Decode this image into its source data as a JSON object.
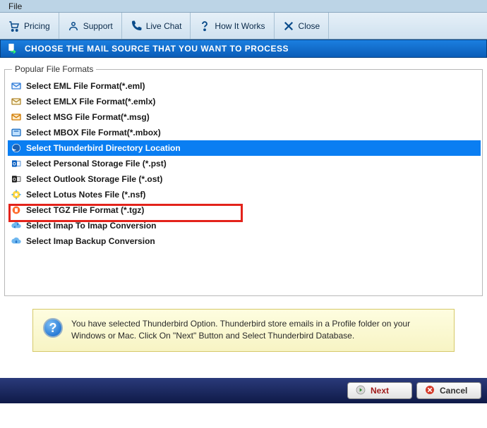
{
  "menubar": {
    "file": "File"
  },
  "toolbar": {
    "pricing": "Pricing",
    "support": "Support",
    "livechat": "Live Chat",
    "howitworks": "How It Works",
    "close": "Close"
  },
  "header": {
    "title": "CHOOSE THE MAIL SOURCE THAT YOU WANT TO PROCESS"
  },
  "group": {
    "legend": "Popular File Formats"
  },
  "formats": {
    "items": [
      {
        "label": "Select EML File Format(*.eml)"
      },
      {
        "label": "Select EMLX File Format(*.emlx)"
      },
      {
        "label": "Select MSG File Format(*.msg)"
      },
      {
        "label": "Select MBOX File Format(*.mbox)"
      },
      {
        "label": "Select Thunderbird Directory Location"
      },
      {
        "label": "Select Personal Storage File (*.pst)"
      },
      {
        "label": "Select Outlook Storage File (*.ost)"
      },
      {
        "label": "Select Lotus Notes File (*.nsf)"
      },
      {
        "label": "Select TGZ File Format (*.tgz)"
      },
      {
        "label": "Select Imap To Imap Conversion"
      },
      {
        "label": "Select Imap Backup Conversion"
      }
    ],
    "selected_index": 4
  },
  "info": {
    "text": "You have selected Thunderbird Option. Thunderbird store emails in a Profile folder on your Windows or Mac. Click On \"Next\" Button and Select Thunderbird Database."
  },
  "buttons": {
    "next": "Next",
    "cancel": "Cancel"
  },
  "colors": {
    "selection_bg": "#0a7ef2",
    "highlight_border": "#e3231b",
    "header_gradient_from": "#1b7fe0",
    "header_gradient_to": "#0b5db8",
    "bottombar_gradient_from": "#2a3a7a",
    "bottombar_gradient_to": "#0f1a48"
  }
}
